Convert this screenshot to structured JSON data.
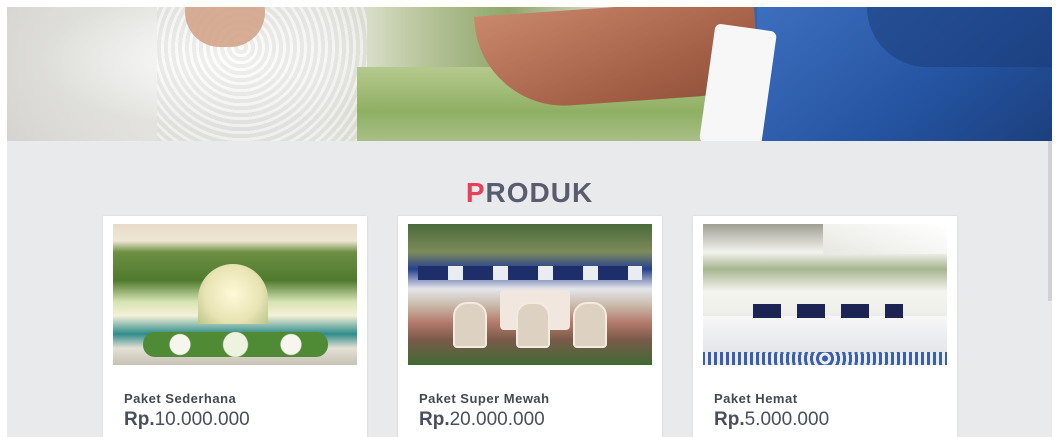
{
  "section": {
    "title_first_letter": "P",
    "title_rest": "RODUK"
  },
  "products": [
    {
      "name": "Paket Sederhana",
      "currency": "Rp.",
      "amount": "10.000.000",
      "image_alt": "Dekorasi pelaminan hijau putih"
    },
    {
      "name": "Paket Super Mewah",
      "currency": "Rp.",
      "amount": "20.000.000",
      "image_alt": "Dekorasi pelaminan biru mewah"
    },
    {
      "name": "Paket Hemat",
      "currency": "Rp.",
      "amount": "5.000.000",
      "image_alt": "Dekorasi pelaminan putih biru"
    }
  ],
  "colors": {
    "accent": "#e8405a",
    "title": "#575d6f",
    "background": "#e9eaec"
  }
}
